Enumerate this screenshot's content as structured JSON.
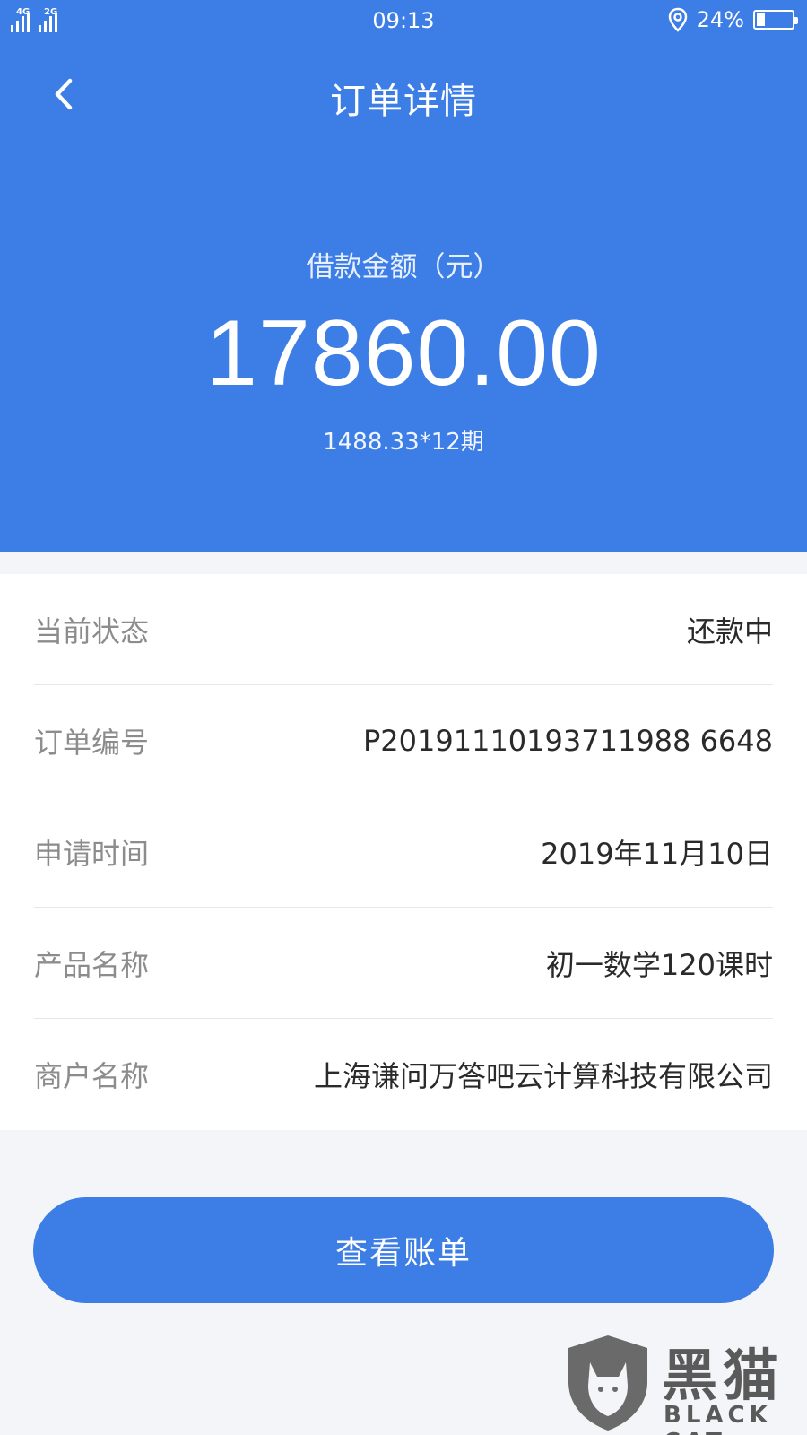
{
  "status_bar": {
    "time": "09:13",
    "network_1": "4G",
    "network_2": "2G",
    "battery_percent_text": "24%",
    "battery_level": 0.24,
    "icons": [
      "signal-icon",
      "location-icon",
      "battery-icon"
    ]
  },
  "nav": {
    "title": "订单详情",
    "back_icon": "chevron-left-icon"
  },
  "summary": {
    "amount_label": "借款金额（元）",
    "amount": "17860.00",
    "installment": "1488.33*12期"
  },
  "details": [
    {
      "label": "当前状态",
      "value": "还款中"
    },
    {
      "label": "订单编号",
      "value": "P20191110193711988 6648"
    },
    {
      "label": "申请时间",
      "value": "2019年11月10日"
    },
    {
      "label": "产品名称",
      "value": "初一数学120课时"
    },
    {
      "label": "商户名称",
      "value": "上海谦问万答吧云计算科技有限公司"
    }
  ],
  "actions": {
    "view_bill": "查看账单"
  },
  "watermark": {
    "title": "黑猫",
    "subtitle": "BLACK CAT"
  },
  "colors": {
    "primary": "#3c7ee6",
    "background": "#f4f5f9",
    "label": "#8c8c8c",
    "value": "#2a2a2a"
  }
}
